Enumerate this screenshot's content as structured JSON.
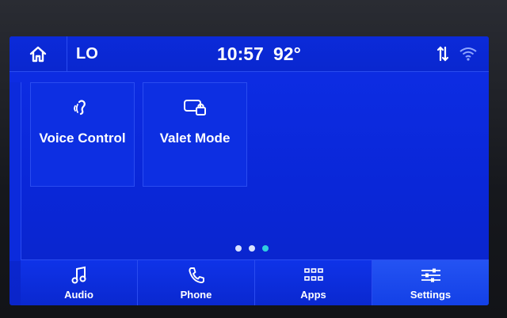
{
  "statusbar": {
    "home_icon": "home-icon",
    "temperature_setting": "LO",
    "time": "10:57",
    "outside_temp": "92°",
    "data_icon": "data-transfer-icon",
    "wifi_icon": "wifi-icon"
  },
  "tiles": [
    {
      "label": "Voice Control",
      "icon": "voice-control-icon"
    },
    {
      "label": "Valet Mode",
      "icon": "valet-lock-icon"
    }
  ],
  "pages": {
    "count": 3,
    "active_index": 2
  },
  "bottom_nav": [
    {
      "label": "Audio",
      "icon": "music-note-icon"
    },
    {
      "label": "Phone",
      "icon": "phone-icon"
    },
    {
      "label": "Apps",
      "icon": "apps-grid-icon"
    },
    {
      "label": "Settings",
      "icon": "settings-sliders-icon"
    }
  ],
  "colors": {
    "screen_blue": "#0a27d8",
    "active_dot": "#2fd0e0",
    "text": "#ffffff"
  }
}
